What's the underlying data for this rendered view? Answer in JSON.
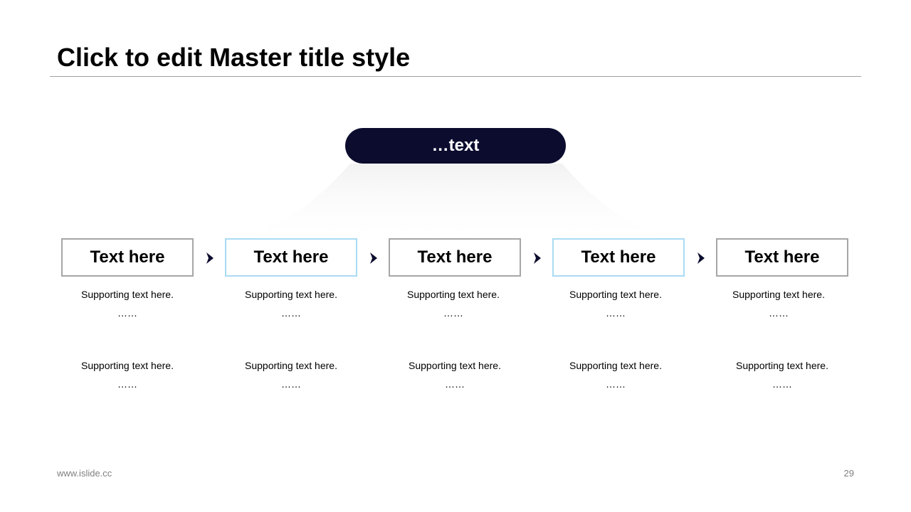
{
  "title": "Click to edit Master title style",
  "center_label": "…text",
  "steps": [
    {
      "label": "Text here",
      "accent": false,
      "support": [
        {
          "line": "Supporting text here.",
          "dots": "……"
        },
        {
          "line": "Supporting text here.",
          "dots": "……"
        }
      ]
    },
    {
      "label": "Text here",
      "accent": true,
      "support": [
        {
          "line": "Supporting text here.",
          "dots": "……"
        },
        {
          "line": "Supporting text here.",
          "dots": "……"
        }
      ]
    },
    {
      "label": "Text here",
      "accent": false,
      "support": [
        {
          "line": "Supporting text here.",
          "dots": "……"
        },
        {
          "line": "Supporting text here.",
          "dots": "……"
        }
      ]
    },
    {
      "label": "Text here",
      "accent": true,
      "support": [
        {
          "line": "Supporting text here.",
          "dots": "……"
        },
        {
          "line": "Supporting text here.",
          "dots": "……"
        }
      ]
    },
    {
      "label": "Text here",
      "accent": false,
      "support": [
        {
          "line": "Supporting text here.",
          "dots": "……"
        },
        {
          "line": "Supporting text here.",
          "dots": "……"
        }
      ]
    }
  ],
  "footer": {
    "website": "www.islide.cc",
    "page_number": "29"
  },
  "colors": {
    "pill": "#0b0c2e",
    "box_border": "#a6a6a6",
    "accent_border": "#a9dbf4",
    "arrow": "#0b0c2e"
  }
}
